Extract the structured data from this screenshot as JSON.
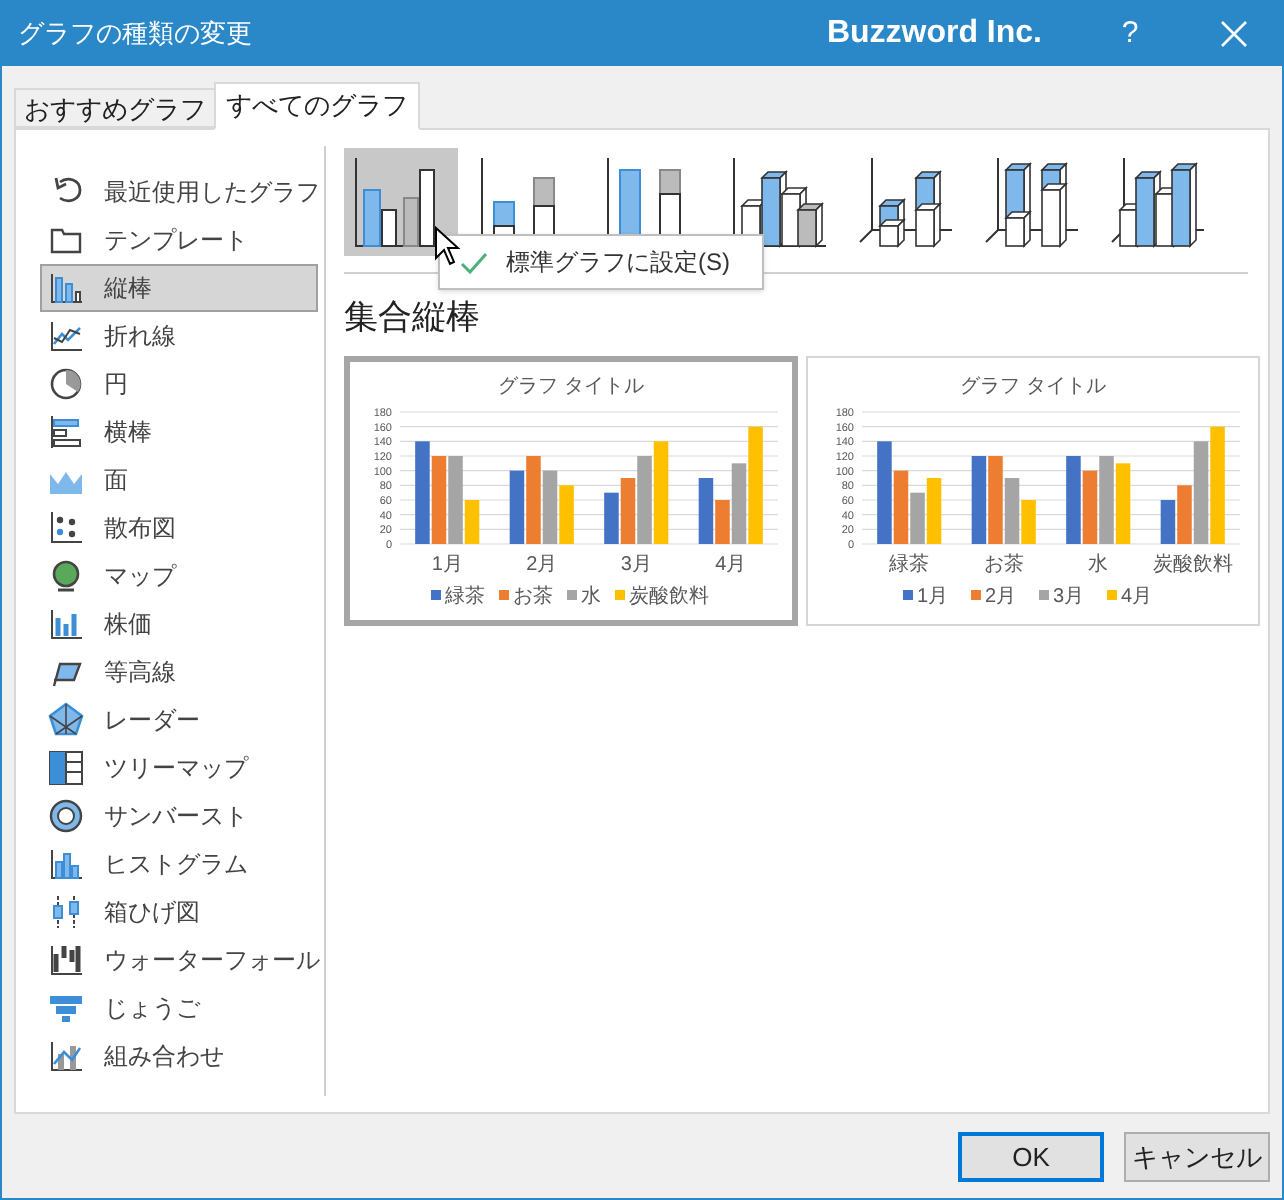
{
  "window": {
    "title": "グラフの種類の変更",
    "brand": "Buzzword Inc.",
    "help": "?"
  },
  "tabs": [
    {
      "label": "おすすめグラフ",
      "selected": false
    },
    {
      "label": "すべてのグラフ",
      "selected": true
    }
  ],
  "chart_types": [
    {
      "label": "最近使用したグラフ",
      "selected": false
    },
    {
      "label": "テンプレート",
      "selected": false
    },
    {
      "label": "縦棒",
      "selected": true
    },
    {
      "label": "折れ線",
      "selected": false
    },
    {
      "label": "円",
      "selected": false
    },
    {
      "label": "横棒",
      "selected": false
    },
    {
      "label": "面",
      "selected": false
    },
    {
      "label": "散布図",
      "selected": false
    },
    {
      "label": "マップ",
      "selected": false
    },
    {
      "label": "株価",
      "selected": false
    },
    {
      "label": "等高線",
      "selected": false
    },
    {
      "label": "レーダー",
      "selected": false
    },
    {
      "label": "ツリーマップ",
      "selected": false
    },
    {
      "label": "サンバースト",
      "selected": false
    },
    {
      "label": "ヒストグラム",
      "selected": false
    },
    {
      "label": "箱ひげ図",
      "selected": false
    },
    {
      "label": "ウォーターフォール",
      "selected": false
    },
    {
      "label": "じょうご",
      "selected": false
    },
    {
      "label": "組み合わせ",
      "selected": false
    }
  ],
  "subtypes": [
    {
      "selected": true
    },
    {
      "selected": false
    },
    {
      "selected": false
    },
    {
      "selected": false
    },
    {
      "selected": false
    },
    {
      "selected": false
    },
    {
      "selected": false
    }
  ],
  "tooltip": {
    "label": "標準グラフに設定(S)"
  },
  "subtype_title": "集合縦棒",
  "previews": [
    {
      "selected": true,
      "chart_data": {
        "type": "bar",
        "title": "グラフ タイトル",
        "grid": true,
        "legend": true,
        "categories": [
          "1月",
          "2月",
          "3月",
          "4月"
        ],
        "ylim": [
          0,
          180
        ],
        "yticks": [
          0,
          20,
          40,
          60,
          80,
          100,
          120,
          140,
          160,
          180
        ],
        "series": [
          {
            "name": "緑茶",
            "color": "#4472c4",
            "values": [
              140,
              100,
              70,
              90
            ]
          },
          {
            "name": "お茶",
            "color": "#ed7d31",
            "values": [
              120,
              120,
              90,
              60
            ]
          },
          {
            "name": "水",
            "color": "#a5a5a5",
            "values": [
              120,
              100,
              120,
              110
            ]
          },
          {
            "name": "炭酸飲料",
            "color": "#ffc000",
            "values": [
              60,
              80,
              140,
              160
            ]
          }
        ]
      }
    },
    {
      "selected": false,
      "chart_data": {
        "type": "bar",
        "title": "グラフ タイトル",
        "grid": true,
        "legend": true,
        "categories": [
          "緑茶",
          "お茶",
          "水",
          "炭酸飲料"
        ],
        "ylim": [
          0,
          180
        ],
        "yticks": [
          0,
          20,
          40,
          60,
          80,
          100,
          120,
          140,
          160,
          180
        ],
        "series": [
          {
            "name": "1月",
            "color": "#4472c4",
            "values": [
              140,
              120,
              120,
              60
            ]
          },
          {
            "name": "2月",
            "color": "#ed7d31",
            "values": [
              100,
              120,
              100,
              80
            ]
          },
          {
            "name": "3月",
            "color": "#a5a5a5",
            "values": [
              70,
              90,
              120,
              140
            ]
          },
          {
            "name": "4月",
            "color": "#ffc000",
            "values": [
              90,
              60,
              110,
              160
            ]
          }
        ]
      }
    }
  ],
  "buttons": [
    {
      "label": "OK",
      "default": true
    },
    {
      "label": "キャンセル",
      "default": false
    }
  ]
}
